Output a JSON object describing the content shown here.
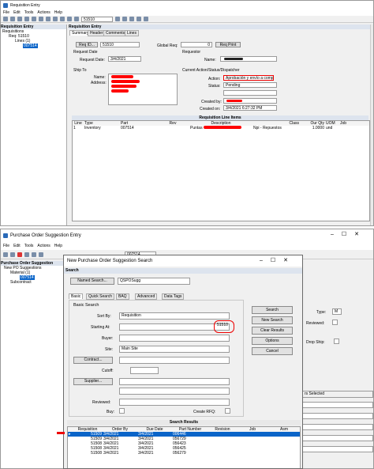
{
  "w1": {
    "title": "Requisition Entry",
    "menu": [
      "File",
      "Edit",
      "Tools",
      "Actions",
      "Help"
    ],
    "tool_field": "51510",
    "tree_header": "Requisition Entry",
    "tree": [
      "Requisitions",
      "Req: 51510",
      "Lines (1)",
      "007514"
    ],
    "panel_header": "Requisition Entry",
    "tabs": [
      "Summary",
      "Header",
      "Comments",
      "Lines"
    ],
    "req_id_btn": "Req ID...",
    "req_id": "51510",
    "global_req_lbl": "Global Req:",
    "global_req": "0",
    "req_print_btn": "Req Print",
    "request_date_grp": "Request Date",
    "request_date_lbl": "Request Date:",
    "request_date": "3/4/2021",
    "requestor_grp": "Requestor",
    "name_lbl": "Name:",
    "ship_to_grp": "Ship To",
    "ship_name_lbl": "Name:",
    "address_lbl": "Address:",
    "action_grp": "Current Action/Status/Dispatcher",
    "action_lbl": "Action:",
    "action": "Aprobación y envío a compras",
    "status_lbl": "Status:",
    "status": "Pending",
    "created_by_lbl": "Created by:",
    "created_on_lbl": "Created on:",
    "created_on": "3/4/2021 6:27:32 PM",
    "lines_hdr": "Requisition Line Items",
    "line_cols": [
      "Line",
      "Type",
      "Part",
      "Rev",
      "Description",
      "Class",
      "Our Qty",
      "UOM",
      "Job"
    ],
    "line_row": {
      "line": "1",
      "type": "Inventory",
      "part": "007514",
      "desc": "Puntas",
      "class": "Npi - Repuestos",
      "qty": "1.0000",
      "uom": "und"
    }
  },
  "w2": {
    "title": "Purchase Order Suggestion Entry",
    "menu": [
      "File",
      "Edit",
      "Tools",
      "Actions",
      "Help"
    ],
    "tool_field": "007514",
    "tree_header": "Purchase Order Suggestion",
    "tree": [
      "New PO Suggestions",
      "Material (1)",
      "007514",
      "Subcontract"
    ],
    "right_labels": {
      "type": "Type:",
      "type_val": "M",
      "reviewed": "Reviewed:",
      "drop_ship": "Drop Ship:",
      "buyers_sel": "rs Selected"
    }
  },
  "dlg": {
    "title": "New Purchase Order Suggestion Search",
    "search_hdr": "Search",
    "named_search_btn": "Named Search...",
    "named_search": "QSPOSugg",
    "tabs": [
      "Basic",
      "Quick Search",
      "BAQ",
      "Advanced",
      "Data Tags"
    ],
    "basic_grp": "Basic Search",
    "sort_by_lbl": "Sort By:",
    "sort_by": "Requisition",
    "starting_at_lbl": "Starting At:",
    "starting_at": "51510",
    "buyer_lbl": "Buyer:",
    "site_lbl": "Site:",
    "site": "Main Site",
    "contract_btn": "Contract...",
    "cutoff_lbl": "Cutoff:",
    "supplier_btn": "Supplier...",
    "reviewed_lbl": "Reviewed:",
    "buy_lbl": "Buy:",
    "create_rfq_lbl": "Create RFQ:",
    "buttons": [
      "Search",
      "New Search",
      "Clear Results",
      "Options",
      "Cancel"
    ],
    "results_hdr": "Search Results",
    "cols": [
      "Requisition",
      "Order By",
      "Due Date",
      "Part Number",
      "Revision",
      "Job",
      "Asm"
    ],
    "rows": [
      [
        "51509",
        "3/4/2021",
        "3/4/2021",
        "006446"
      ],
      [
        "51509",
        "3/4/2021",
        "3/4/2021",
        "056729"
      ],
      [
        "51508",
        "3/4/2021",
        "3/4/2021",
        "056423"
      ],
      [
        "51508",
        "3/4/2021",
        "3/4/2021",
        "056425"
      ],
      [
        "51508",
        "3/4/2021",
        "3/4/2021",
        "056279"
      ]
    ]
  }
}
